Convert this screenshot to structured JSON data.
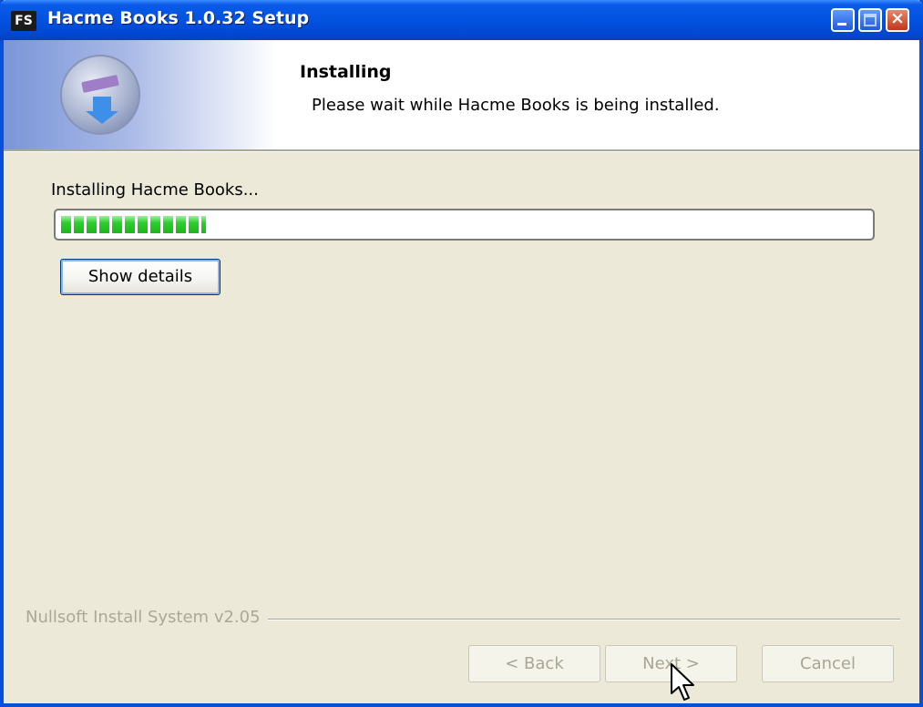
{
  "window": {
    "title": "Hacme Books 1.0.32 Setup",
    "app_icon_text": "FS",
    "controls": [
      "minimize-icon",
      "maximize-icon",
      "close-icon"
    ]
  },
  "header": {
    "title": "Installing",
    "subtitle": "Please wait while Hacme Books is being installed."
  },
  "main": {
    "status_text": "Installing Hacme Books...",
    "progress_fraction": 0.18,
    "show_details_label": "Show details"
  },
  "footer": {
    "branding": "Nullsoft Install System v2.05",
    "back_label": "< Back",
    "next_label": "Next >",
    "cancel_label": "Cancel"
  },
  "colors": {
    "titlebar": "#0a5ae8",
    "progress": "#2bcf2b",
    "dialog_bg": "#ece9d8"
  }
}
